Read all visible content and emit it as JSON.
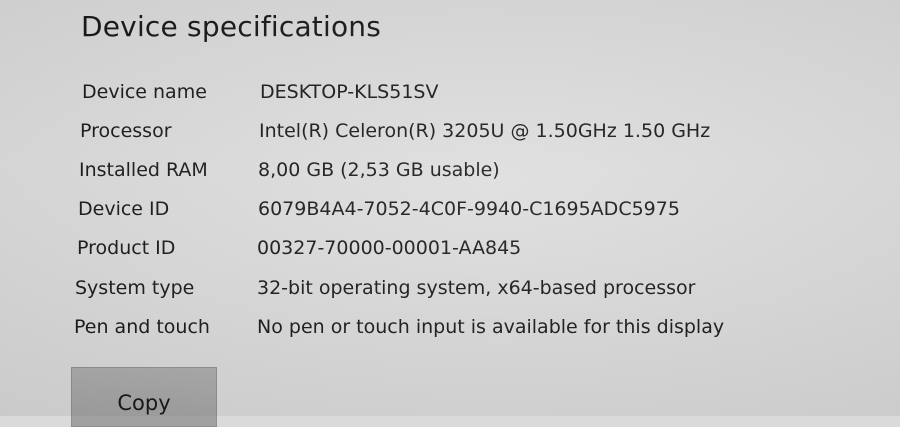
{
  "section": {
    "title": "Device specifications"
  },
  "specs": [
    {
      "label": "Device name",
      "value": "DESKTOP-KLS51SV"
    },
    {
      "label": "Processor",
      "value": "Intel(R) Celeron(R) 3205U @ 1.50GHz   1.50 GHz"
    },
    {
      "label": "Installed RAM",
      "value": "8,00 GB (2,53 GB usable)"
    },
    {
      "label": "Device ID",
      "value": "6079B4A4-7052-4C0F-9940-C1695ADC5975"
    },
    {
      "label": "Product ID",
      "value": "00327-70000-00001-AA845"
    },
    {
      "label": "System type",
      "value": "32-bit operating system, x64-based processor"
    },
    {
      "label": "Pen and touch",
      "value": "No pen or touch input is available for this display"
    }
  ],
  "actions": {
    "copy_label": "Copy"
  }
}
